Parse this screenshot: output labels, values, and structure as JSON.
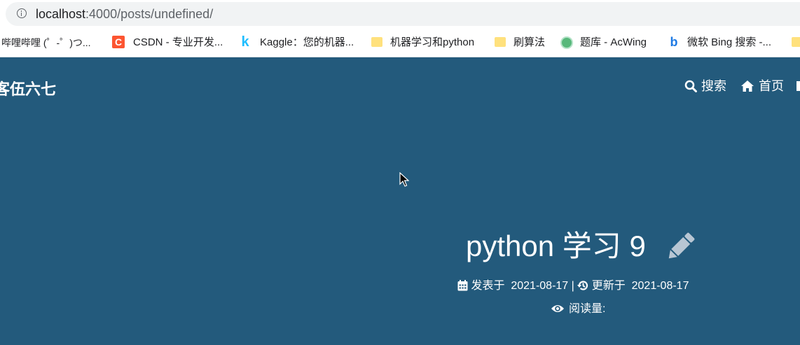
{
  "browser": {
    "url_host": "localhost",
    "url_path": ":4000/posts/undefined/"
  },
  "bookmarks": [
    {
      "label": "哔哩哔哩 (゜-゜)つ...",
      "icon": "bilibili-icon"
    },
    {
      "label": "CSDN - 专业开发...",
      "icon": "csdn-icon"
    },
    {
      "label": "Kaggle：您的机器...",
      "icon": "kaggle-icon"
    },
    {
      "label": "机器学习和python",
      "icon": "folder-icon"
    },
    {
      "label": "刷算法",
      "icon": "folder-icon"
    },
    {
      "label": "题库 - AcWing",
      "icon": "acwing-icon"
    },
    {
      "label": "微软 Bing 搜索 -...",
      "icon": "bing-icon"
    }
  ],
  "site": {
    "title": "客伍六七"
  },
  "nav": {
    "search_label": "搜索",
    "home_label": "首页"
  },
  "post": {
    "title": "python 学习 9",
    "published_label": "发表于",
    "published_date": "2021-08-17",
    "separator": "|",
    "updated_label": "更新于",
    "updated_date": "2021-08-17",
    "views_label": "阅读量:"
  },
  "colors": {
    "hero_background": "#235a7c"
  }
}
